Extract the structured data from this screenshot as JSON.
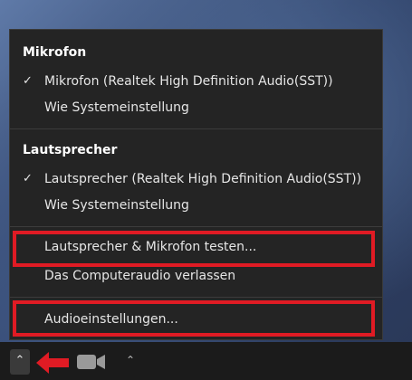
{
  "mikrofon": {
    "title": "Mikrofon",
    "items": [
      {
        "check": "✓",
        "label": "Mikrofon (Realtek High Definition Audio(SST))"
      },
      {
        "check": "",
        "label": "Wie Systemeinstellung"
      }
    ]
  },
  "lautsprecher": {
    "title": "Lautsprecher",
    "items": [
      {
        "check": "✓",
        "label": "Lautsprecher (Realtek High Definition Audio(SST))"
      },
      {
        "check": "",
        "label": "Wie Systemeinstellung"
      }
    ]
  },
  "actions": {
    "test_label": "Lautsprecher & Mikrofon testen...",
    "leave_label": "Das Computeraudio verlassen",
    "settings_label": "Audioeinstellungen..."
  },
  "taskbar": {
    "audio_caret": "⌃",
    "video_caret": "⌃"
  },
  "colors": {
    "highlight": "#e01b24",
    "menu_bg": "#242424"
  }
}
